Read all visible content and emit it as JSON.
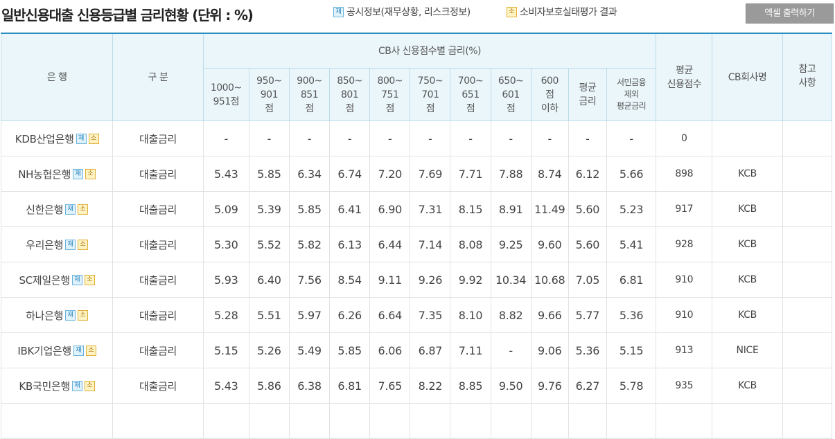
{
  "title": "일반신용대출 신용등급별 금리현황 (단위 : %)",
  "legend": [
    {
      "badge": "재",
      "label": "공시정보(재무상황, 리스크정보)",
      "icon": "disclosure-badge-icon",
      "color": "#1c7dba"
    },
    {
      "badge": "소",
      "label": "소비자보호실태평가 결과",
      "icon": "consumer-protection-badge-icon",
      "color": "#a8750b"
    }
  ],
  "excel_button": "엑셀 출력하기",
  "header": {
    "bank": "은 행",
    "kind": "구 분",
    "group": "CB사 신용점수별 금리(%)",
    "avg_score": "평균\n신용점수",
    "cb_company": "CB회사명",
    "reference": "참고\n사항",
    "columns": [
      "1000~\n951점",
      "950~\n901\n점",
      "900~\n851\n점",
      "850~\n801\n점",
      "800~\n751\n점",
      "750~\n701\n점",
      "700~\n651\n점",
      "650~\n601\n점",
      "600\n점\n이하",
      "평균\n금리",
      "서민금융\n제외\n평균금리"
    ]
  },
  "badges": {
    "jae": "재",
    "so": "소"
  },
  "rows": [
    {
      "bank": "KDB산업은행",
      "kind": "대출금리",
      "rates": [
        "-",
        "-",
        "-",
        "-",
        "-",
        "-",
        "-",
        "-",
        "-",
        "-",
        "-"
      ],
      "avg_score": "0",
      "cb": "",
      "note": ""
    },
    {
      "bank": "NH농협은행",
      "kind": "대출금리",
      "rates": [
        "5.43",
        "5.85",
        "6.34",
        "6.74",
        "7.20",
        "7.69",
        "7.71",
        "7.88",
        "8.74",
        "6.12",
        "5.66"
      ],
      "avg_score": "898",
      "cb": "KCB",
      "note": ""
    },
    {
      "bank": "신한은행",
      "kind": "대출금리",
      "rates": [
        "5.09",
        "5.39",
        "5.85",
        "6.41",
        "6.90",
        "7.31",
        "8.15",
        "8.91",
        "11.49",
        "5.60",
        "5.23"
      ],
      "avg_score": "917",
      "cb": "KCB",
      "note": ""
    },
    {
      "bank": "우리은행",
      "kind": "대출금리",
      "rates": [
        "5.30",
        "5.52",
        "5.82",
        "6.13",
        "6.44",
        "7.14",
        "8.08",
        "9.25",
        "9.60",
        "5.60",
        "5.41"
      ],
      "avg_score": "928",
      "cb": "KCB",
      "note": ""
    },
    {
      "bank": "SC제일은행",
      "kind": "대출금리",
      "rates": [
        "5.93",
        "6.40",
        "7.56",
        "8.54",
        "9.11",
        "9.26",
        "9.92",
        "10.34",
        "10.68",
        "7.05",
        "6.81"
      ],
      "avg_score": "910",
      "cb": "KCB",
      "note": ""
    },
    {
      "bank": "하나은행",
      "kind": "대출금리",
      "rates": [
        "5.28",
        "5.51",
        "5.97",
        "6.26",
        "6.64",
        "7.35",
        "8.10",
        "8.82",
        "9.66",
        "5.77",
        "5.36"
      ],
      "avg_score": "910",
      "cb": "KCB",
      "note": ""
    },
    {
      "bank": "IBK기업은행",
      "kind": "대출금리",
      "rates": [
        "5.15",
        "5.26",
        "5.49",
        "5.85",
        "6.06",
        "6.87",
        "7.11",
        "-",
        "9.06",
        "5.36",
        "5.15"
      ],
      "avg_score": "913",
      "cb": "NICE",
      "note": ""
    },
    {
      "bank": "KB국민은행",
      "kind": "대출금리",
      "rates": [
        "5.43",
        "5.86",
        "6.38",
        "6.81",
        "7.65",
        "8.22",
        "8.85",
        "9.50",
        "9.76",
        "6.27",
        "5.78"
      ],
      "avg_score": "935",
      "cb": "KCB",
      "note": ""
    },
    {
      "bank": "",
      "kind": "",
      "rates": [
        "",
        "",
        "",
        "",
        "",
        "",
        "",
        "",
        "",
        "",
        ""
      ],
      "avg_score": "",
      "cb": "",
      "note": ""
    }
  ]
}
